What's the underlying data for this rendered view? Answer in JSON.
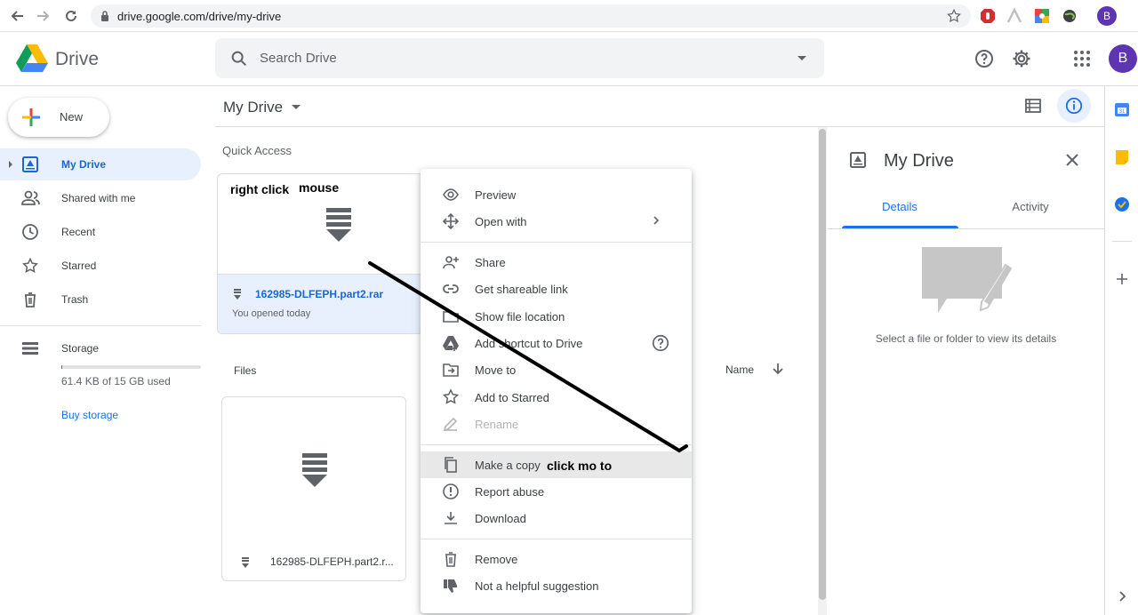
{
  "browser": {
    "url": "drive.google.com/drive/my-drive",
    "profile_initial": "B"
  },
  "header": {
    "app_name": "Drive",
    "search_placeholder": "Search Drive",
    "avatar_initial": "B"
  },
  "sidebar": {
    "new_label": "New",
    "items": [
      {
        "label": "My Drive"
      },
      {
        "label": "Shared with me"
      },
      {
        "label": "Recent"
      },
      {
        "label": "Starred"
      },
      {
        "label": "Trash"
      },
      {
        "label": "Storage"
      }
    ],
    "storage_used_fraction": 0.004,
    "storage_used": "61.4 KB of 15 GB used",
    "buy_storage": "Buy storage"
  },
  "main": {
    "title": "My Drive",
    "quick_access_label": "Quick Access",
    "quick_access_file": {
      "name": "162985-DLFEPH.part2.rar",
      "subtitle": "You opened today"
    },
    "files_label": "Files",
    "sort_label": "Name",
    "file": {
      "name": "162985-DLFEPH.part2.r..."
    }
  },
  "annotations": {
    "right_click": "right click",
    "mouse": "mouse",
    "click_mo_to": "click mo to"
  },
  "context_menu": {
    "groups": [
      [
        {
          "label": "Preview",
          "icon": "eye-icon"
        },
        {
          "label": "Open with",
          "icon": "move-arrows-icon",
          "submenu": true
        }
      ],
      [
        {
          "label": "Share",
          "icon": "person-add-icon"
        },
        {
          "label": "Get shareable link",
          "icon": "link-icon"
        },
        {
          "label": "Show file location",
          "icon": "folder-icon"
        },
        {
          "label": "Add shortcut to Drive",
          "icon": "drive-shortcut-icon",
          "help": true
        },
        {
          "label": "Move to",
          "icon": "move-to-icon"
        },
        {
          "label": "Add to Starred",
          "icon": "star-icon"
        },
        {
          "label": "Rename",
          "icon": "pencil-icon",
          "disabled": true
        }
      ],
      [
        {
          "label": "Make a copy",
          "icon": "copy-icon",
          "hover": true
        },
        {
          "label": "Report abuse",
          "icon": "alert-icon"
        },
        {
          "label": "Download",
          "icon": "download-icon"
        }
      ],
      [
        {
          "label": "Remove",
          "icon": "trash-icon"
        },
        {
          "label": "Not a helpful suggestion",
          "icon": "thumb-down-icon"
        }
      ]
    ]
  },
  "details_panel": {
    "title": "My Drive",
    "tabs": [
      "Details",
      "Activity"
    ],
    "empty_text": "Select a file or folder to view its details"
  },
  "colors": {
    "accent": "#1a73e8",
    "active_bg": "#e8f0fe",
    "avatar": "#5e35b1"
  }
}
